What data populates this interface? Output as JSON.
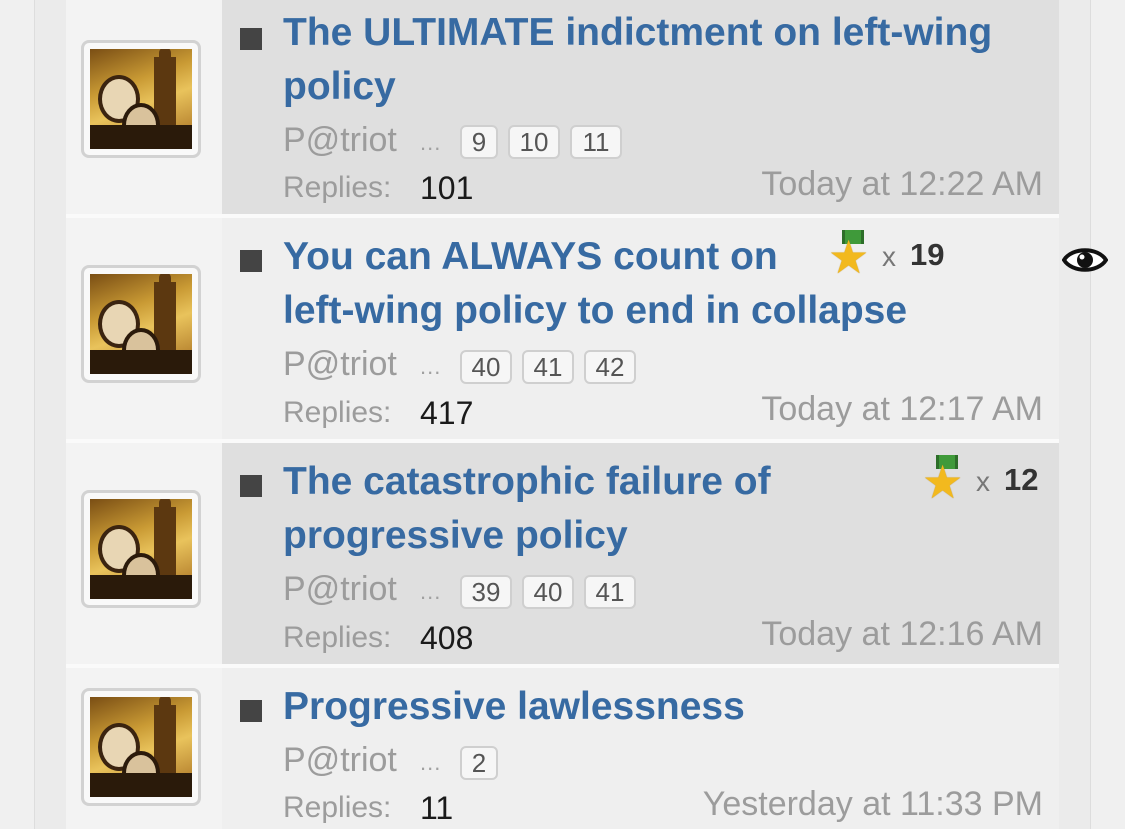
{
  "threads": [
    {
      "title_line1": "The ULTIMATE indictment on left-wing",
      "title_line2": "policy",
      "author": "P@triot",
      "ellipsis": "...",
      "pages": [
        "9",
        "10",
        "11"
      ],
      "replies_label": "Replies:",
      "replies": "101",
      "date": "Today at 12:22 AM",
      "avatar_icon": "founding-fathers-avatar"
    },
    {
      "title_line1": "You can ALWAYS count on",
      "title_line2": "left-wing policy to end in collapse",
      "author": "P@triot",
      "ellipsis": "...",
      "pages": [
        "40",
        "41",
        "42"
      ],
      "replies_label": "Replies:",
      "replies": "417",
      "date": "Today at 12:17 AM",
      "award_icon": "star-medal-icon",
      "award_x": "x",
      "award_count": "19",
      "watch_icon": "eye-icon",
      "avatar_icon": "founding-fathers-avatar"
    },
    {
      "title_line1": "The catastrophic failure of",
      "title_line2": "progressive policy",
      "author": "P@triot",
      "ellipsis": "...",
      "pages": [
        "39",
        "40",
        "41"
      ],
      "replies_label": "Replies:",
      "replies": "408",
      "date": "Today at 12:16 AM",
      "award_icon": "star-medal-icon",
      "award_x": "x",
      "award_count": "12",
      "avatar_icon": "founding-fathers-avatar"
    },
    {
      "title_line1": "Progressive lawlessness",
      "author": "P@triot",
      "ellipsis": "...",
      "pages": [
        "2"
      ],
      "replies_label": "Replies:",
      "replies": "11",
      "date": "Yesterday at 11:33 PM",
      "avatar_icon": "founding-fathers-avatar"
    }
  ],
  "colors": {
    "title_link": "#376aa2",
    "muted_text": "#9c9c9c",
    "row_highlight": "#dfdfdf",
    "row_normal": "#efefef",
    "star": "#f2b91e",
    "ribbon": "#3f9a3a"
  }
}
